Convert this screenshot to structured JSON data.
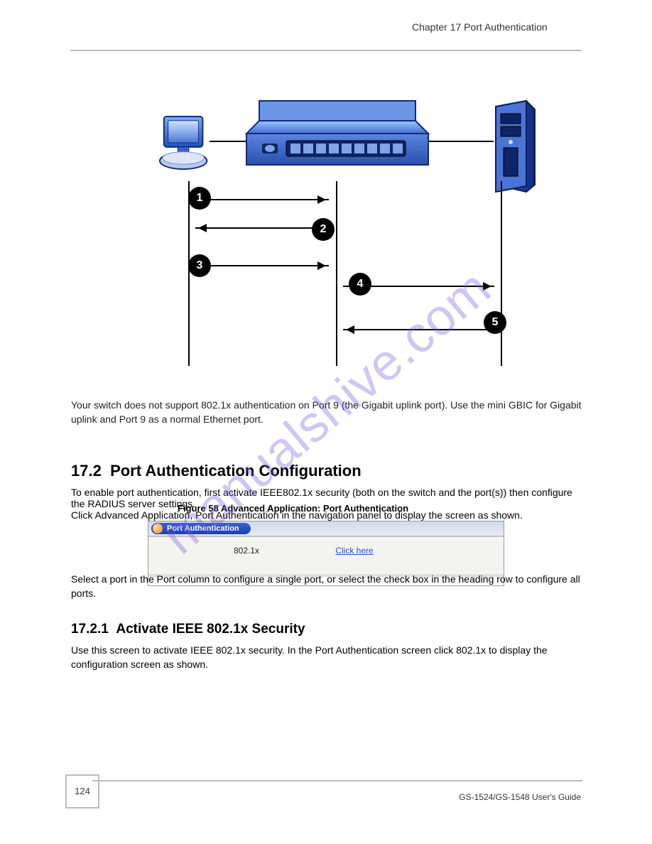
{
  "header": {
    "chapter": "Chapter 17 Port Authentication"
  },
  "diagram": {
    "circles": [
      "1",
      "2",
      "3",
      "4",
      "5"
    ]
  },
  "body_paragraph": "Your switch does not support 802.1x authentication on Port 9 (the Gigabit uplink port). Use the mini GBIC for Gigabit uplink and Port 9 as a normal Ethernet port.",
  "section": {
    "number": "17.2",
    "title": "Port Authentication Configuration",
    "intro": "To enable port authentication, first activate IEEE802.1x security (both on the switch and the port(s)) then configure the RADIUS server settings.",
    "nav": "Click Advanced Application, Port Authentication in the navigation panel to display the screen as shown.",
    "fig_caption": "Figure 58   Advanced Application: Port Authentication"
  },
  "portauth": {
    "panel_title": "Port Authentication",
    "row_label": "802.1x",
    "row_link": "Click here"
  },
  "after_fig": "Select a port in the Port column to configure a single port, or select the check box in the heading row to configure all ports.",
  "subsection": {
    "number": "17.2.1",
    "title": "Activate IEEE 802.1x Security",
    "text": "Use this screen to activate IEEE 802.1x security. In the Port Authentication screen click 802.1x to display the configuration screen as shown."
  },
  "footer": {
    "page": "124",
    "manual": "GS-1524/GS-1548 User's Guide"
  },
  "watermark": "manualshive.com"
}
